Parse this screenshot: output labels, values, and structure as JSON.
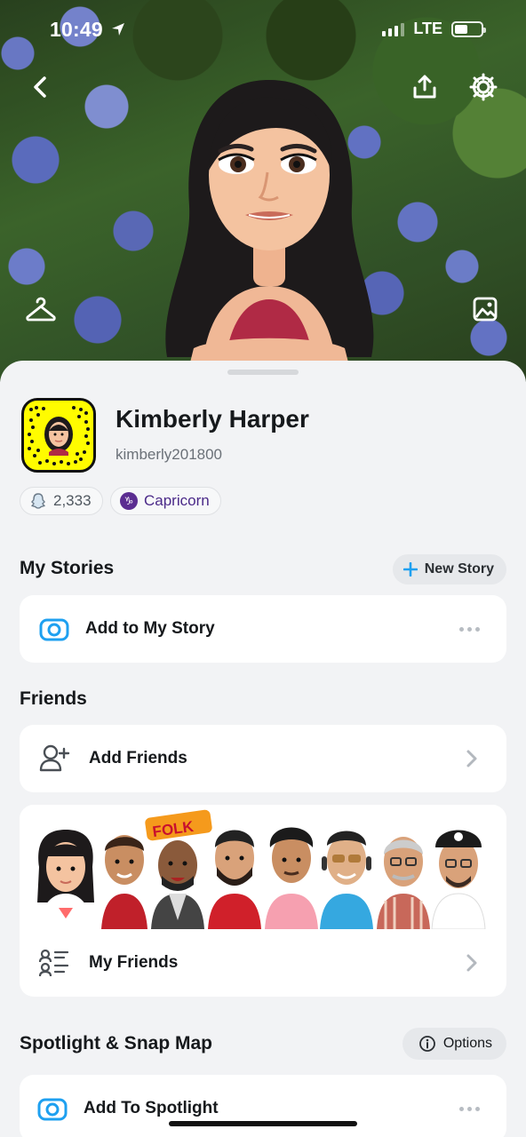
{
  "status_bar": {
    "time": "10:49",
    "network": "LTE"
  },
  "profile": {
    "name": "Kimberly Harper",
    "username": "kimberly201800",
    "snap_score": "2,333",
    "zodiac": "Capricorn",
    "zodiac_symbol": "♑"
  },
  "my_stories": {
    "title": "My Stories",
    "new_story_label": "New Story",
    "add_story_label": "Add to My Story"
  },
  "friends": {
    "title": "Friends",
    "add_friends_label": "Add Friends",
    "my_friends_label": "My Friends",
    "banner_text": "FOLK"
  },
  "spotlight": {
    "title": "Spotlight & Snap Map",
    "options_label": "Options",
    "add_spotlight_label": "Add To Spotlight"
  },
  "colors": {
    "snap_yellow": "#fffc00",
    "accent_blue": "#1ea0f0",
    "zodiac_purple": "#5b2d91"
  }
}
